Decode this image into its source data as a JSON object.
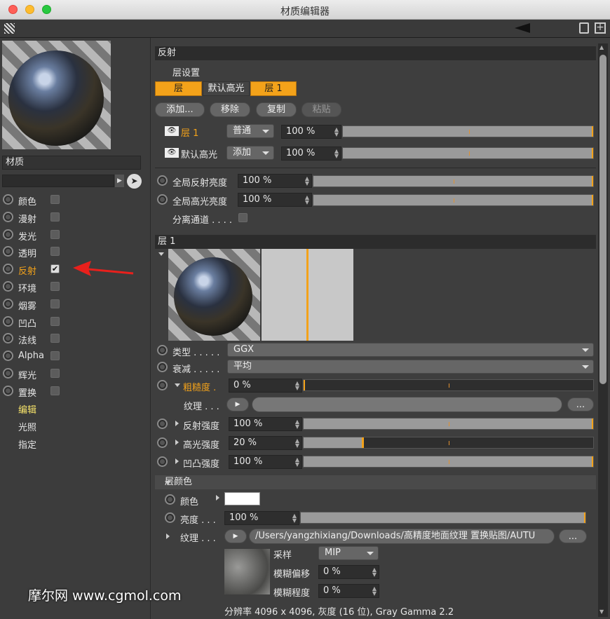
{
  "window": {
    "title": "材质编辑器"
  },
  "left": {
    "material_label": "材质",
    "channels": [
      {
        "label": "颜色",
        "checked": false,
        "active": false
      },
      {
        "label": "漫射",
        "checked": false,
        "active": false
      },
      {
        "label": "发光",
        "checked": false,
        "active": false
      },
      {
        "label": "透明",
        "checked": false,
        "active": false
      },
      {
        "label": "反射",
        "checked": true,
        "active": true
      },
      {
        "label": "环境",
        "checked": false,
        "active": false
      },
      {
        "label": "烟雾",
        "checked": false,
        "active": false
      },
      {
        "label": "凹凸",
        "checked": false,
        "active": false
      },
      {
        "label": "法线",
        "checked": false,
        "active": false
      },
      {
        "label": "Alpha",
        "checked": false,
        "active": false
      },
      {
        "label": "辉光",
        "checked": false,
        "active": false
      },
      {
        "label": "置换",
        "checked": false,
        "active": false
      }
    ],
    "extras": [
      "编辑",
      "光照",
      "指定"
    ]
  },
  "reflect": {
    "header": "反射",
    "layer_settings": "层设置",
    "tabs": [
      "层",
      "默认高光",
      "层 1"
    ],
    "buttons": [
      "添加...",
      "移除",
      "复制",
      "粘贴"
    ],
    "layers": [
      {
        "name": "层 1",
        "mode": "普通",
        "value": "100 %"
      },
      {
        "name": "默认高光",
        "mode": "添加",
        "value": "100 %"
      }
    ],
    "global_reflect_label": "全局反射亮度",
    "global_reflect_value": "100 %",
    "global_spec_label": "全局高光亮度",
    "global_spec_value": "100 %",
    "separate_label": "分离通道 . . . ."
  },
  "layer1": {
    "header": "层 1",
    "type_label": "类型 . . . . .",
    "type_value": "GGX",
    "atten_label": "衰减 . . . . .",
    "atten_value": "平均",
    "rough_label": "粗糙度 .",
    "rough_value": "0 %",
    "texture_label": "纹理 . . .",
    "more_btn": "...",
    "refl_strength_label": "反射强度",
    "refl_strength_value": "100 %",
    "spec_strength_label": "高光强度",
    "spec_strength_value": "20 %",
    "bump_strength_label": "凹凸强度",
    "bump_strength_value": "100 %"
  },
  "layer_color": {
    "header": "层颜色",
    "color_label": "颜色",
    "brightness_label": "亮度 . . .",
    "brightness_value": "100 %",
    "texture_label": "纹理 . . .",
    "texture_path": "/Users/yangzhixiang/Downloads/高精度地面纹理 置换贴图/AUTU",
    "sampling_label": "采样",
    "sampling_value": "MIP",
    "blur_offset_label": "模糊偏移",
    "blur_offset_value": "0 %",
    "blur_scale_label": "模糊程度",
    "blur_scale_value": "0 %",
    "resolution": "分辨率 4096 x 4096, 灰度 (16 位), Gray Gamma 2.2"
  },
  "watermark": "摩尔网 www.cgmol.com",
  "colors": {
    "accent": "#f3a21a",
    "panel": "#3e3e3e",
    "arrow": "#e8201c"
  }
}
